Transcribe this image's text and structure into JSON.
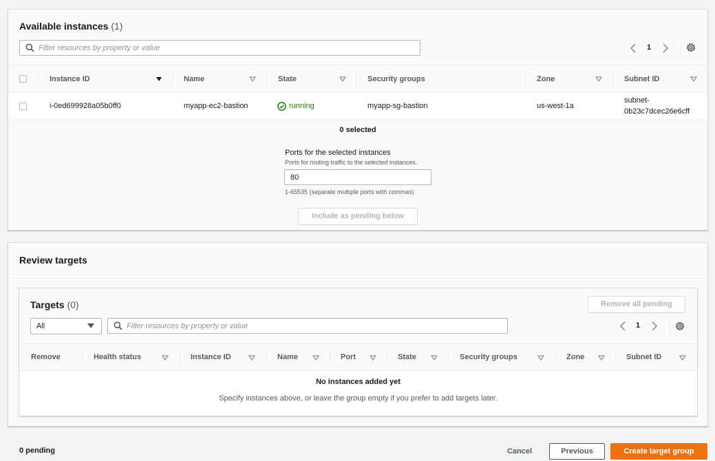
{
  "available": {
    "title": "Available instances",
    "count": "(1)",
    "search_placeholder": "Filter resources by property or value",
    "page": "1",
    "columns": [
      "Instance ID",
      "Name",
      "State",
      "Security groups",
      "Zone",
      "Subnet ID"
    ],
    "row": {
      "instance_id": "i-0ed699928a05b0ff0",
      "name": "myapp-ec2-bastion",
      "state": "running",
      "security_groups": "myapp-sg-bastion",
      "zone": "us-west-1a",
      "subnet_line1": "subnet-",
      "subnet_line2": "0b23c7dcec26e6cff"
    },
    "selected_text": "0 selected",
    "ports_label": "Ports for the selected instances",
    "ports_description": "Ports for routing traffic to the selected instances.",
    "ports_value": "80",
    "ports_hint": "1-65535 (separate multiple ports with commas)",
    "include_button": "Include as pending below"
  },
  "review": {
    "title": "Review targets",
    "targets_title": "Targets",
    "targets_count": "(0)",
    "remove_all_button": "Remove all pending",
    "filter_select": "All",
    "search_placeholder": "Filter resources by property or value",
    "page": "1",
    "columns": [
      "Remove",
      "Health status",
      "Instance ID",
      "Name",
      "Port",
      "State",
      "Security groups",
      "Zone",
      "Subnet ID"
    ],
    "empty_title": "No instances added yet",
    "empty_text": "Specify instances above, or leave the group empty if you prefer to add targets later."
  },
  "footer": {
    "pending": "0 pending",
    "cancel": "Cancel",
    "previous": "Previous",
    "create": "Create target group"
  },
  "colors": {
    "primary_button": "#ec7211",
    "success": "#1d8102",
    "border": "#d5dbdb"
  }
}
